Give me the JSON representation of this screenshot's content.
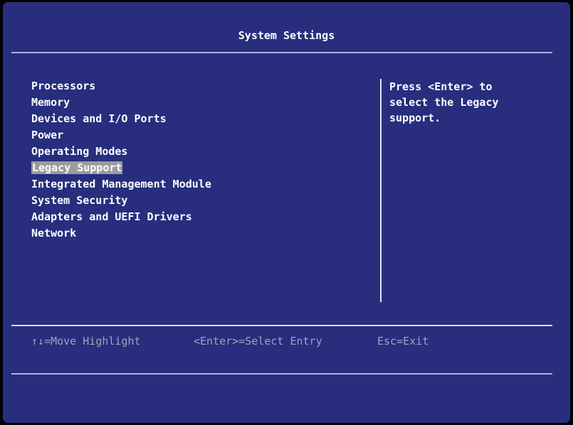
{
  "header": {
    "title": "System Settings"
  },
  "menu": {
    "items": [
      {
        "label": "Processors",
        "selected": false
      },
      {
        "label": "Memory",
        "selected": false
      },
      {
        "label": "Devices and I/O Ports",
        "selected": false
      },
      {
        "label": "Power",
        "selected": false
      },
      {
        "label": "Operating Modes",
        "selected": false
      },
      {
        "label": "Legacy Support",
        "selected": true
      },
      {
        "label": "Integrated Management Module",
        "selected": false
      },
      {
        "label": "System Security",
        "selected": false
      },
      {
        "label": "Adapters and UEFI Drivers",
        "selected": false
      },
      {
        "label": "Network",
        "selected": false
      }
    ]
  },
  "help": {
    "text": "Press <Enter> to\nselect the Legacy\nsupport."
  },
  "footer": {
    "hints": [
      {
        "label": "↑↓=Move Highlight"
      },
      {
        "label": "<Enter>=Select Entry"
      },
      {
        "label": "Esc=Exit"
      }
    ]
  },
  "colors": {
    "background": "#282d7e",
    "highlight": "#9c9c9c",
    "text": "#ffffff",
    "hint_text": "#a3a3b8"
  }
}
